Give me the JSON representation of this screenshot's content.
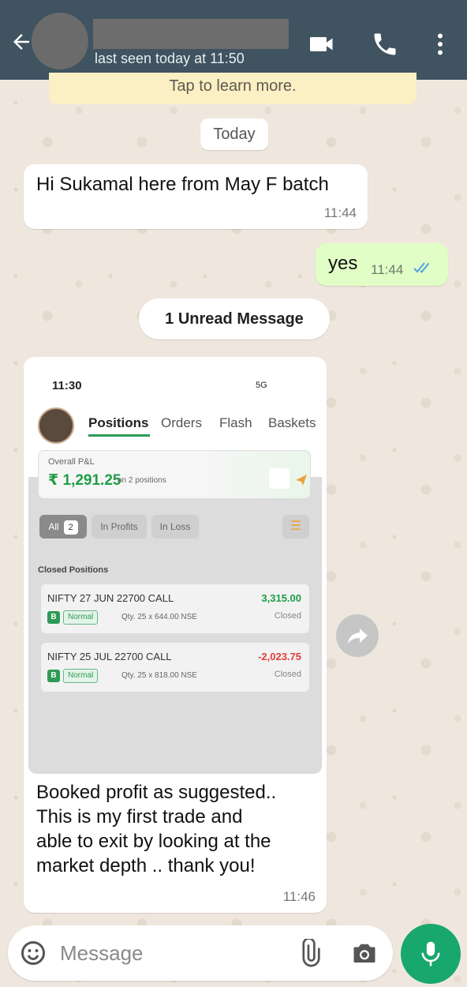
{
  "header": {
    "last_seen": "last seen today at 11:50",
    "back_icon": "arrow-left-icon",
    "video_icon": "video-camera-icon",
    "call_icon": "phone-icon",
    "menu_icon": "more-vertical-icon",
    "bg_color": "#3f5360"
  },
  "encryption_banner": {
    "text": "Tap to learn more."
  },
  "date_chip": "Today",
  "messages": [
    {
      "direction": "incoming",
      "text": "Hi Sukamal here from May F batch",
      "time": "11:44"
    },
    {
      "direction": "outgoing",
      "text": "yes",
      "time": "11:44",
      "status": "read"
    },
    {
      "direction": "incoming",
      "caption": "Booked profit as suggested..\nThis is my first trade and\nable to exit by looking at the\nmarket depth .. thank you!",
      "time": "11:46",
      "screenshot": {
        "time": "11:30",
        "status_bar": "5G",
        "tabs": [
          "Positions",
          "Orders",
          "Flash",
          "Baskets"
        ],
        "active_tab": "Positions",
        "pnl": {
          "label": "Overall P&L",
          "value": "₹ 1,291.25",
          "sub": "on 2 positions"
        },
        "filters": {
          "all_label": "All",
          "all_count": "2",
          "profits": "In Profits",
          "loss": "In Loss"
        },
        "section_title": "Closed Positions",
        "positions": [
          {
            "name": "NIFTY 27 JUN 22700 CALL",
            "amount": "3,315.00",
            "side": "B",
            "type": "Normal",
            "qty": "Qty. 25 x 644.00  NSE",
            "status": "Closed"
          },
          {
            "name": "NIFTY 25 JUL 22700 CALL",
            "amount": "-2,023.75",
            "side": "B",
            "type": "Normal",
            "qty": "Qty. 25 x 818.00  NSE",
            "status": "Closed"
          }
        ]
      }
    }
  ],
  "unread_chip": "1 Unread Message",
  "input": {
    "placeholder": "Message"
  },
  "colors": {
    "outgoing_bubble": "#e1fec6",
    "accent_green": "#18a76c",
    "read_ticks": "#4fa3e0"
  }
}
